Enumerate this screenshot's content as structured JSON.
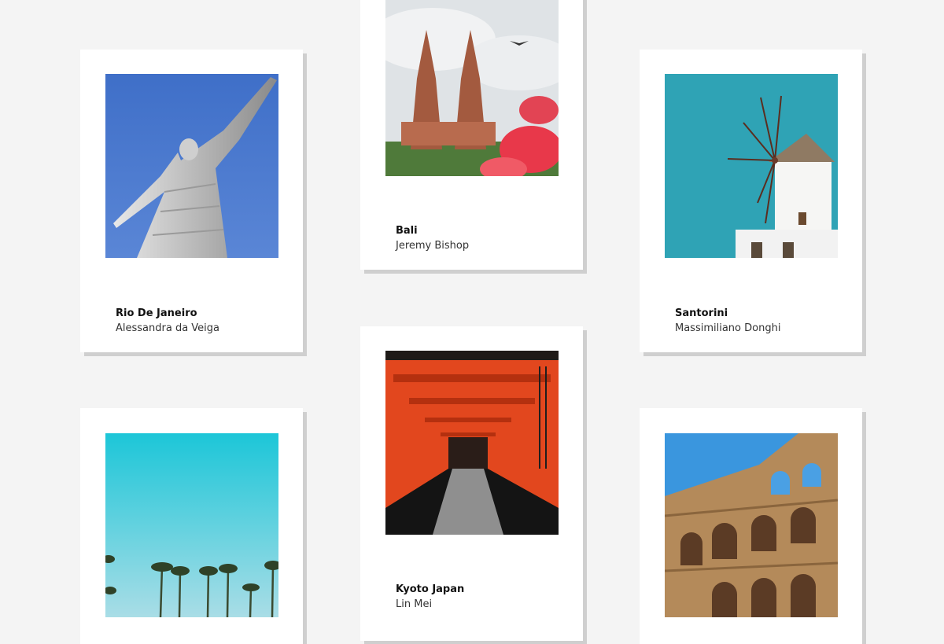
{
  "cards": [
    {
      "title": "Rio De Janeiro",
      "author": "Alessandra da Veiga",
      "photo": "christ-the-redeemer-statue"
    },
    {
      "title": "Bali",
      "author": "Jeremy Bishop",
      "photo": "bali-temple-gate"
    },
    {
      "title": "Santorini",
      "author": "Massimiliano Donghi",
      "photo": "santorini-windmill"
    },
    {
      "title": "",
      "author": "",
      "photo": "palm-trees-sky"
    },
    {
      "title": "Kyoto Japan",
      "author": "Lin Mei",
      "photo": "torii-gate-tunnel"
    },
    {
      "title": "",
      "author": "",
      "photo": "colosseum-arches"
    }
  ]
}
